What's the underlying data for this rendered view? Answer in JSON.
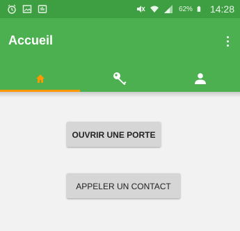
{
  "status_bar": {
    "battery_percent": "62%",
    "time": "14:28",
    "left_icons": [
      "alarm-icon",
      "image-icon",
      "notification-icon"
    ],
    "right_icons": [
      "mute-icon",
      "wifi-icon",
      "signal-icon",
      "battery-icon"
    ]
  },
  "app_bar": {
    "title": "Accueil",
    "menu_icon": "overflow-menu-icon",
    "background": "#4caf50"
  },
  "tabs": [
    {
      "icon": "home-icon",
      "selected": true
    },
    {
      "icon": "key-icon",
      "selected": false
    },
    {
      "icon": "person-icon",
      "selected": false
    }
  ],
  "colors": {
    "status_bar": "#3e9e42",
    "accent": "#ff9800",
    "button": "#d6d6d6",
    "background": "#f2f2f2"
  },
  "buttons": {
    "open_door": "OUVRIR UNE PORTE",
    "call_contact": "APPELER UN CONTACT"
  }
}
